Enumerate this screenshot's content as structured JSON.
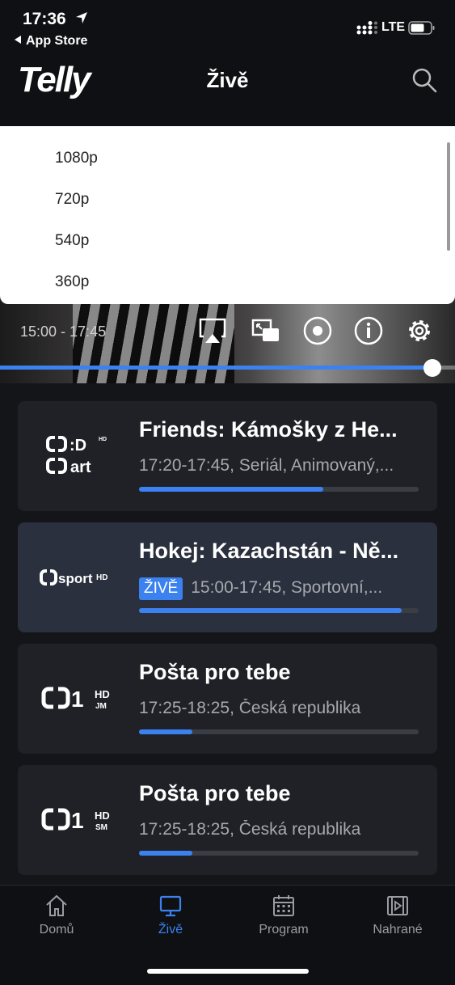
{
  "status_bar": {
    "time": "17:36",
    "back_label": "App Store",
    "network": "LTE"
  },
  "header": {
    "logo": "Telly",
    "title": "Živě"
  },
  "quality_menu": {
    "options": [
      "1080p",
      "720p",
      "540p",
      "360p"
    ]
  },
  "player": {
    "time_range": "15:00 - 17:45",
    "progress": 0.95
  },
  "channels": [
    {
      "title": "Friends: Kámošky z He...",
      "info": "17:20-17:45, Seriál, Animovaný,...",
      "progress": 0.66,
      "live": false
    },
    {
      "title": "Hokej: Kazachstán - Ně...",
      "badge": "ŽIVĚ",
      "info": "15:00-17:45, Sportovní,...",
      "progress": 0.94,
      "live": true
    },
    {
      "title": "Pošta pro tebe",
      "info": "17:25-18:25, Česká republika",
      "progress": 0.19,
      "live": false
    },
    {
      "title": "Pošta pro tebe",
      "info": "17:25-18:25, Česká republika",
      "progress": 0.19,
      "live": false
    }
  ],
  "channel_logos": [
    {
      "line1": ":D",
      "line1_sup": "HD",
      "line2": "art"
    },
    {
      "text": "sport",
      "sup": "HD"
    },
    {
      "text": "1",
      "sup": "HD",
      "sub": "JM"
    },
    {
      "text": "1",
      "sup": "HD",
      "sub": "SM"
    }
  ],
  "tabs": [
    {
      "label": "Domů",
      "icon": "home-icon"
    },
    {
      "label": "Živě",
      "icon": "tv-icon",
      "active": true
    },
    {
      "label": "Program",
      "icon": "calendar-icon"
    },
    {
      "label": "Nahrané",
      "icon": "film-icon"
    }
  ],
  "colors": {
    "accent": "#3b82f0",
    "background": "#141519",
    "card": "#1f2126",
    "card_active": "#2a303d"
  }
}
